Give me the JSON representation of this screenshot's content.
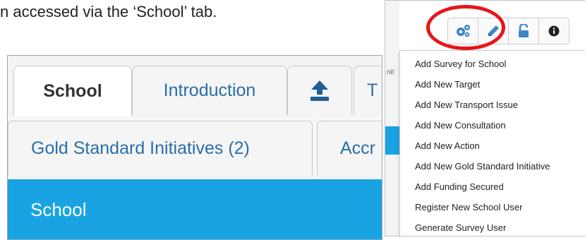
{
  "document": {
    "text": "n accessed via the ‘School’ tab."
  },
  "left_panel": {
    "tabs": [
      {
        "label": "School",
        "active": true
      },
      {
        "label": "Introduction",
        "active": false
      },
      {
        "icon": "upload-icon"
      },
      {
        "label": "T",
        "active": false
      }
    ],
    "subtabs": [
      {
        "label": "Gold Standard Initiatives (2)"
      },
      {
        "label": "Accr"
      }
    ],
    "section_title": "School"
  },
  "right_panel": {
    "side_text": "nit",
    "toolbar": [
      {
        "icon": "gears-icon",
        "color": "#3a87c9"
      },
      {
        "icon": "pencil-icon",
        "color": "#3a87c9"
      },
      {
        "icon": "unlock-icon",
        "color": "#3a87c9"
      },
      {
        "icon": "info-icon",
        "color": "#222222"
      }
    ],
    "highlight_color": "#e8141b",
    "menu_items": [
      "Add Survey for School",
      "Add New Target",
      "Add New Transport Issue",
      "Add New Consultation",
      "Add New Action",
      "Add New Gold Standard Initiative",
      "Add Funding Secured",
      "Register New School User",
      "Generate Survey User"
    ]
  },
  "colors": {
    "accent_blue": "#1aa3e3",
    "link_blue": "#2a6fa8"
  }
}
